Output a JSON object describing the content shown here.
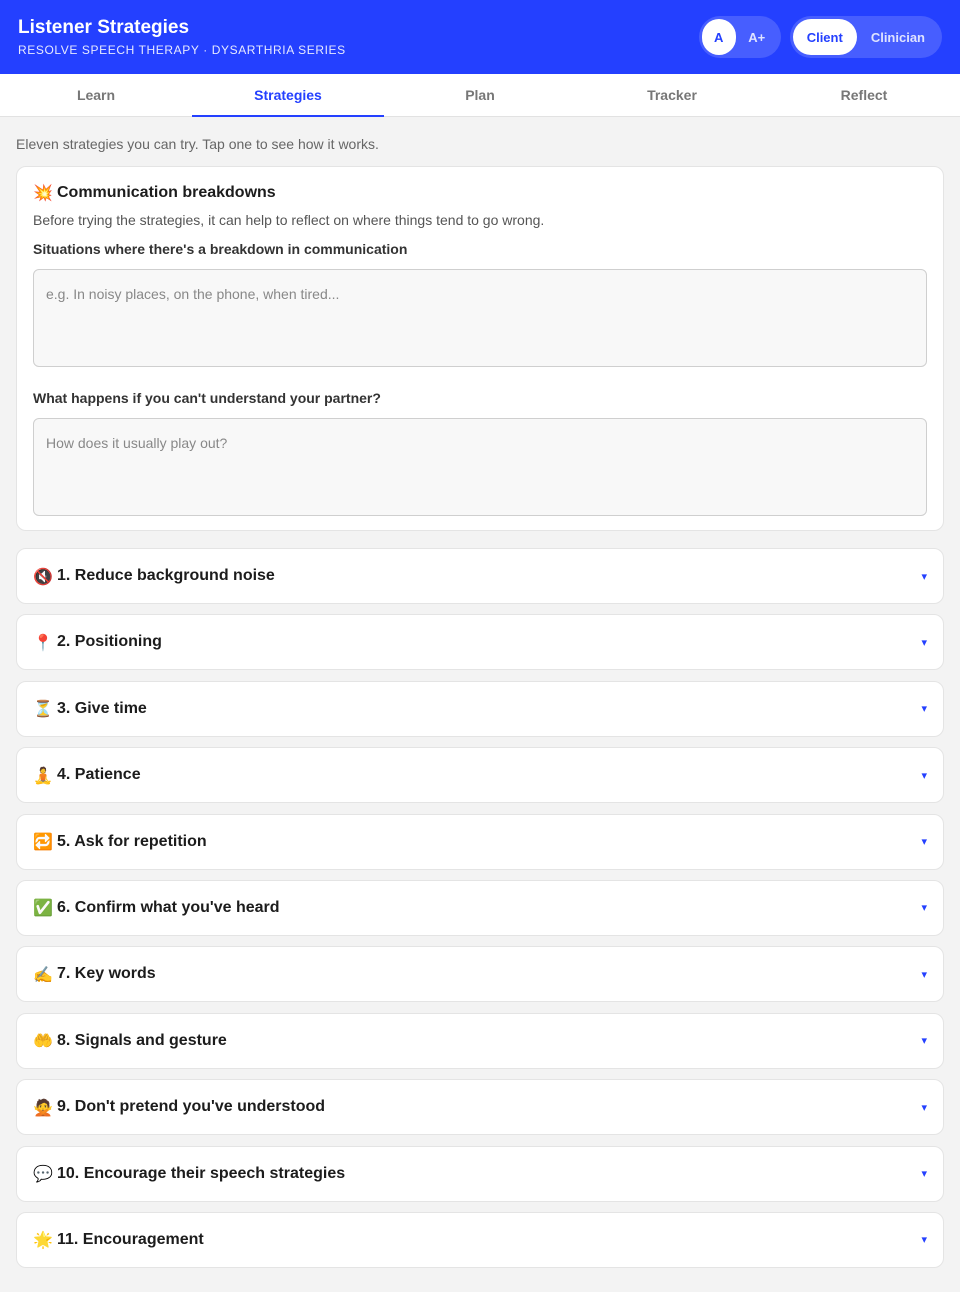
{
  "header": {
    "title": "Listener Strategies",
    "subtitle": "RESOLVE SPEECH THERAPY · DYSARTHRIA SERIES",
    "text_size": {
      "normal": "A",
      "large": "A+",
      "active": "normal"
    },
    "mode": {
      "client": "Client",
      "clinician": "Clinician",
      "active": "client"
    },
    "accent_color": "#2440ff"
  },
  "tabs": [
    {
      "label": "Learn"
    },
    {
      "label": "Strategies",
      "active": true
    },
    {
      "label": "Plan"
    },
    {
      "label": "Tracker"
    },
    {
      "label": "Reflect"
    }
  ],
  "intro": "Eleven strategies you can try. Tap one to see how it works.",
  "breakdowns": {
    "icon": "💥",
    "title": "Communication breakdowns",
    "description": "Before trying the strategies, it can help to reflect on where things tend to go wrong.",
    "q1_label": "Situations where there's a breakdown in communication",
    "q1_placeholder": "e.g. In noisy places, on the phone, when tired...",
    "q1_value": "",
    "q2_label": "What happens if you can't understand your partner?",
    "q2_placeholder": "How does it usually play out?",
    "q2_value": ""
  },
  "strategies": [
    {
      "icon": "🔇",
      "icon_name": "muted-speaker-icon",
      "label": "1. Reduce background noise"
    },
    {
      "icon": "📍",
      "icon_name": "pin-icon",
      "label": "2. Positioning"
    },
    {
      "icon": "⏳",
      "icon_name": "hourglass-icon",
      "label": "3. Give time"
    },
    {
      "icon": "🧘",
      "icon_name": "meditation-icon",
      "label": "4. Patience"
    },
    {
      "icon": "🔁",
      "icon_name": "repeat-icon",
      "label": "5. Ask for repetition"
    },
    {
      "icon": "✅",
      "icon_name": "check-icon",
      "label": "6. Confirm what you've heard"
    },
    {
      "icon": "✍️",
      "icon_name": "writing-hand-icon",
      "label": "7. Key words"
    },
    {
      "icon": "🤲",
      "icon_name": "hands-icon",
      "label": "8. Signals and gesture"
    },
    {
      "icon": "🙅",
      "icon_name": "no-gesture-icon",
      "label": "9. Don't pretend you've understood"
    },
    {
      "icon": "💬",
      "icon_name": "speech-bubble-icon",
      "label": "10. Encourage their speech strategies"
    },
    {
      "icon": "🌟",
      "icon_name": "star-icon",
      "label": "11. Encouragement"
    }
  ],
  "chevron": "▾"
}
